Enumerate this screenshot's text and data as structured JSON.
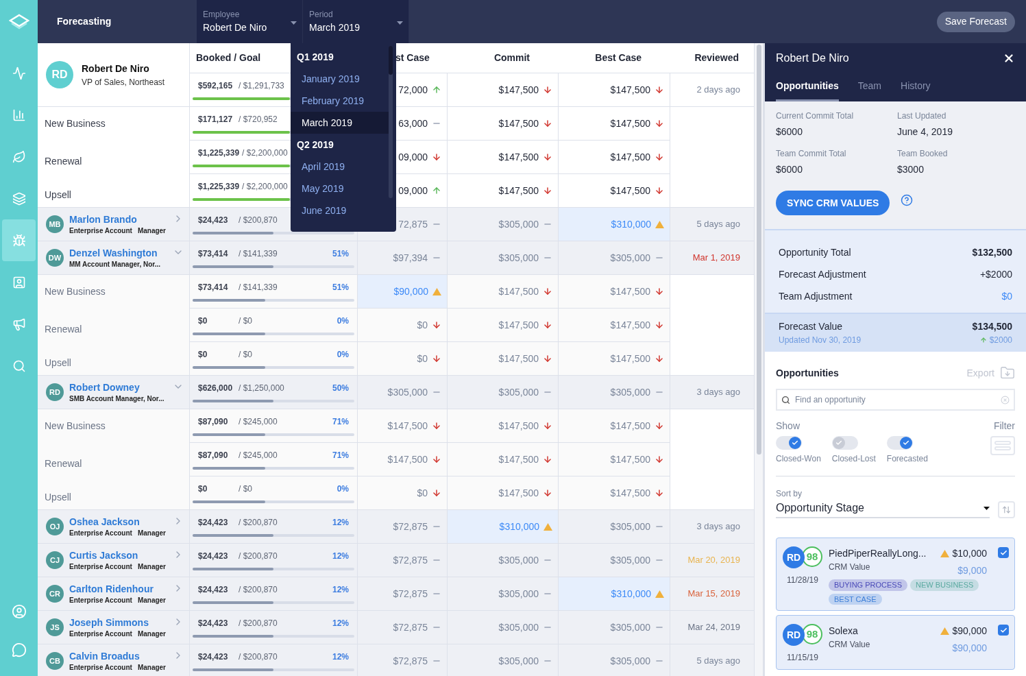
{
  "app": {
    "title": "Forecasting"
  },
  "sidebar": {
    "items": [
      {
        "selected": false
      },
      {
        "selected": false
      },
      {
        "selected": false
      },
      {
        "selected": false
      },
      {
        "selected": true
      },
      {
        "selected": false
      },
      {
        "selected": false
      },
      {
        "selected": false
      }
    ],
    "bottom_items": [
      {
        "selected": false
      },
      {
        "selected": false
      }
    ]
  },
  "header": {
    "filters": [
      {
        "label": "Employee",
        "value": "Robert De Niro"
      },
      {
        "label": "Period",
        "value": "March 2019"
      }
    ],
    "save_button": "Save Forecast"
  },
  "period_menu": {
    "groups": [
      {
        "label": "Q1 2019",
        "items": [
          {
            "label": "January 2019",
            "selected": false
          },
          {
            "label": "February 2019",
            "selected": false
          },
          {
            "label": "March 2019",
            "selected": true
          }
        ]
      },
      {
        "label": "Q2 2019",
        "items": [
          {
            "label": "April 2019",
            "selected": false
          },
          {
            "label": "May 2019",
            "selected": false
          },
          {
            "label": "June 2019",
            "selected": false
          }
        ]
      }
    ]
  },
  "table": {
    "columns": [
      "Booked / Goal",
      "st Case",
      "Commit",
      "Best Case",
      "Reviewed"
    ],
    "owner": {
      "initials": "RD",
      "name": "Robert De Niro",
      "title": "VP of Sales, Northeast",
      "summary": {
        "booked": "$592,165",
        "goal": "/ $1,291,733",
        "level": 0.6,
        "cells": [
          {
            "value": "72,000",
            "kind": "up"
          },
          {
            "value": "$147,500",
            "kind": "down"
          },
          {
            "value": "$147,500",
            "kind": "down"
          }
        ],
        "reviewed": {
          "text": "2 days ago",
          "color": "#7a8599"
        }
      },
      "segments": [
        {
          "label": "New Business",
          "booked": "$171,127",
          "goal": "/ $720,952",
          "level": 0.6,
          "cells": [
            {
              "value": "63,000",
              "kind": "flat"
            },
            {
              "value": "$147,500",
              "kind": "down"
            },
            {
              "value": "$147,500",
              "kind": "down"
            }
          ]
        },
        {
          "label": "Renewal",
          "booked": "$1,225,339",
          "goal": "/ $2,200,000",
          "level": 0.6,
          "cells": [
            {
              "value": "09,000",
              "kind": "down"
            },
            {
              "value": "$147,500",
              "kind": "down"
            },
            {
              "value": "$147,500",
              "kind": "down"
            }
          ]
        },
        {
          "label": "Upsell",
          "booked": "$1,225,339",
          "goal": "/ $2,200,000",
          "level": 0.6,
          "cells": [
            {
              "value": "09,000",
              "kind": "up"
            },
            {
              "value": "$147,500",
              "kind": "down"
            },
            {
              "value": "$147,500",
              "kind": "down"
            }
          ]
        }
      ]
    },
    "members": [
      {
        "initials": "MB",
        "name": "Marlon Brando",
        "title": [
          "Enterprise Account",
          "Manager"
        ],
        "expanded": false,
        "booked": "$24,423",
        "goal": "/ $200,870",
        "level": 0.5,
        "cells": [
          {
            "value": "72,875",
            "kind": "flat"
          },
          {
            "value": "$305,000",
            "kind": "flat"
          },
          {
            "value": "$310,000",
            "kind": "warn"
          }
        ],
        "reviewed": {
          "text": "5 days ago",
          "color": "#7a8599"
        }
      },
      {
        "initials": "DW",
        "name": "Denzel Washington",
        "title": [
          "MM Account Manager, Nor..."
        ],
        "expanded": true,
        "booked": "$73,414",
        "goal": "/ $141,339",
        "percent": "51%",
        "level": 0.5,
        "cells": [
          {
            "value": "$97,394",
            "kind": "flat"
          },
          {
            "value": "$305,000",
            "kind": "flat"
          },
          {
            "value": "$305,000",
            "kind": "flat"
          }
        ],
        "reviewed": {
          "text": "Mar 1,  2019",
          "color": "#d0342c"
        },
        "segments": [
          {
            "label": "New Business",
            "booked": "$73,414",
            "goal": "/ $141,339",
            "percent": "51%",
            "level": 0.45,
            "cells": [
              {
                "value": "$90,000",
                "kind": "warn"
              },
              {
                "value": "$147,500",
                "kind": "down"
              },
              {
                "value": "$147,500",
                "kind": "down"
              }
            ]
          },
          {
            "label": "Renewal",
            "booked": "$0",
            "goal": "/ $0",
            "percent": "0%",
            "level": 0.45,
            "cells": [
              {
                "value": "$0",
                "kind": "down"
              },
              {
                "value": "$147,500",
                "kind": "down"
              },
              {
                "value": "$147,500",
                "kind": "down"
              }
            ]
          },
          {
            "label": "Upsell",
            "booked": "$0",
            "goal": "/ $0",
            "percent": "0%",
            "level": 0.45,
            "cells": [
              {
                "value": "$0",
                "kind": "down"
              },
              {
                "value": "$147,500",
                "kind": "down"
              },
              {
                "value": "$147,500",
                "kind": "down"
              }
            ]
          }
        ]
      },
      {
        "initials": "RD",
        "name": "Robert Downey",
        "title": [
          "SMB Account Manager, Nor..."
        ],
        "expanded": true,
        "booked": "$626,000",
        "goal": "/ $1,250,000",
        "percent": "50%",
        "level": 0.5,
        "cells": [
          {
            "value": "$305,000",
            "kind": "flat"
          },
          {
            "value": "$305,000",
            "kind": "flat"
          },
          {
            "value": "$305,000",
            "kind": "flat"
          }
        ],
        "reviewed": {
          "text": "3 days ago",
          "color": "#7a8599"
        },
        "segments": [
          {
            "label": "New Business",
            "booked": "$87,090",
            "goal": "/ $245,000",
            "percent": "71%",
            "level": 0.45,
            "cells": [
              {
                "value": "$147,500",
                "kind": "down"
              },
              {
                "value": "$147,500",
                "kind": "down"
              },
              {
                "value": "$147,500",
                "kind": "down"
              }
            ]
          },
          {
            "label": "Renewal",
            "booked": "$87,090",
            "goal": "/ $245,000",
            "percent": "71%",
            "level": 0.45,
            "cells": [
              {
                "value": "$147,500",
                "kind": "down"
              },
              {
                "value": "$147,500",
                "kind": "down"
              },
              {
                "value": "$147,500",
                "kind": "down"
              }
            ]
          },
          {
            "label": "Upsell",
            "booked": "$0",
            "goal": "/ $0",
            "percent": "0%",
            "level": 0.45,
            "cells": [
              {
                "value": "$0",
                "kind": "down"
              },
              {
                "value": "$147,500",
                "kind": "down"
              },
              {
                "value": "$147,500",
                "kind": "down"
              }
            ]
          }
        ]
      },
      {
        "initials": "OJ",
        "name": "Oshea Jackson",
        "title": [
          "Enterprise Account",
          "Manager"
        ],
        "expanded": false,
        "booked": "$24,423",
        "goal": "/ $200,870",
        "percent": "12%",
        "level": 0.5,
        "cells": [
          {
            "value": "$72,875",
            "kind": "flat"
          },
          {
            "value": "$310,000",
            "kind": "warn"
          },
          {
            "value": "$305,000",
            "kind": "flat"
          }
        ],
        "reviewed": {
          "text": "3 days ago",
          "color": "#7a8599"
        }
      },
      {
        "initials": "CJ",
        "name": "Curtis Jackson",
        "title": [
          "Enterprise Account",
          "Manager"
        ],
        "expanded": false,
        "booked": "$24,423",
        "goal": "/ $200,870",
        "percent": "12%",
        "level": 0.5,
        "cells": [
          {
            "value": "$72,875",
            "kind": "flat"
          },
          {
            "value": "$305,000",
            "kind": "flat"
          },
          {
            "value": "$305,000",
            "kind": "flat"
          }
        ],
        "reviewed": {
          "text": "Mar 20, 2019",
          "color": "#e8b450"
        }
      },
      {
        "initials": "CR",
        "name": "Carlton Ridenhour",
        "title": [
          "Enterprise Account",
          "Manager"
        ],
        "expanded": false,
        "booked": "$24,423",
        "goal": "/ $200,870",
        "percent": "12%",
        "level": 0.5,
        "cells": [
          {
            "value": "$72,875",
            "kind": "flat"
          },
          {
            "value": "$305,000",
            "kind": "flat"
          },
          {
            "value": "$310,000",
            "kind": "warn"
          }
        ],
        "reviewed": {
          "text": "Mar 15, 2019",
          "color": "#d9623b"
        }
      },
      {
        "initials": "JS",
        "name": "Joseph Simmons",
        "title": [
          "Enterprise Account",
          "Manager"
        ],
        "expanded": false,
        "booked": "$24,423",
        "goal": "/ $200,870",
        "percent": "12%",
        "level": 0.5,
        "cells": [
          {
            "value": "$72,875",
            "kind": "flat"
          },
          {
            "value": "$305,000",
            "kind": "flat"
          },
          {
            "value": "$305,000",
            "kind": "flat"
          }
        ],
        "reviewed": {
          "text": "Mar 24, 2019",
          "color": "#6b7486"
        }
      },
      {
        "initials": "CB",
        "name": "Calvin Broadus",
        "title": [
          "Enterprise Account",
          "Manager"
        ],
        "expanded": false,
        "booked": "$24,423",
        "goal": "/ $200,870",
        "percent": "12%",
        "level": 0.5,
        "cells": [
          {
            "value": "$72,875",
            "kind": "flat"
          },
          {
            "value": "$305,000",
            "kind": "flat"
          },
          {
            "value": "$305,000",
            "kind": "flat"
          }
        ],
        "reviewed": {
          "text": "5 days ago",
          "color": "#7a8599"
        }
      }
    ]
  },
  "panel": {
    "title": "Robert De Niro",
    "tabs": [
      {
        "label": "Opportunities",
        "selected": true
      },
      {
        "label": "Team",
        "selected": false
      },
      {
        "label": "History",
        "selected": false
      }
    ],
    "stats": [
      {
        "label": "Current Commit Total",
        "value": "$6000"
      },
      {
        "label": "Last Updated",
        "value": "June 4, 2019"
      },
      {
        "label": "Team Commit Total",
        "value": "$6000"
      },
      {
        "label": "Team Booked",
        "value": "$3000"
      }
    ],
    "sync_button": "SYNC CRM VALUES",
    "summary": [
      {
        "label": "Opportunity Total",
        "value": "$132,500",
        "kind": "bold"
      },
      {
        "label": "Forecast Adjustment",
        "value": "+$2000",
        "kind": "plain"
      },
      {
        "label": "Team Adjustment",
        "value": "$0",
        "kind": "link"
      }
    ],
    "forecast": {
      "label": "Forecast Value",
      "updated": "Updated Nov 30, 2019",
      "value": "$134,500",
      "change": "$2000"
    },
    "opportunities": {
      "title": "Opportunities",
      "export": "Export",
      "search_placeholder": "Find an opportunity",
      "show_label": "Show",
      "filter_label": "Filter",
      "toggles": [
        {
          "label": "Closed-Won",
          "checked": true
        },
        {
          "label": "Closed-Lost",
          "checked": false
        },
        {
          "label": "Forecasted",
          "checked": true
        }
      ],
      "sort_label": "Sort by",
      "sort_value": "Opportunity Stage",
      "cards": [
        {
          "initials": "RD",
          "score": "98",
          "date": "11/28/19",
          "name": "PiedPiperReallyLong...",
          "crm_label": "CRM Value",
          "amount": "$10,000",
          "crm_value": "$9,000",
          "checked": true,
          "tags": [
            {
              "label": "BUYING PROCESS",
              "color": "#4a4ab8"
            },
            {
              "label": "NEW BUSINESS",
              "color": "#5aa9a0"
            },
            {
              "label": "BEST CASE",
              "color": "#3e7fd8"
            }
          ]
        },
        {
          "initials": "RD",
          "score": "98",
          "date": "11/15/19",
          "name": "Solexa",
          "crm_label": "CRM Value",
          "amount": "$90,000",
          "crm_value": "$90,000",
          "checked": true
        }
      ]
    }
  }
}
